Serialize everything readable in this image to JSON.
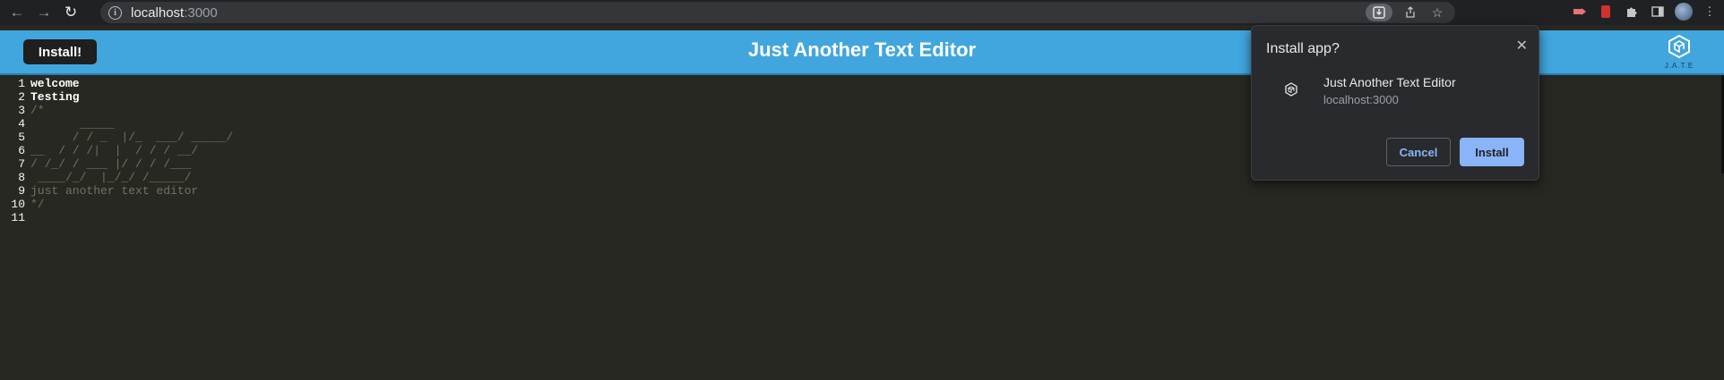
{
  "browser": {
    "url_host": "localhost",
    "url_port": ":3000",
    "icons": [
      "back-arrow-icon",
      "forward-arrow-icon",
      "reload-icon",
      "info-icon",
      "install-app-icon",
      "share-icon",
      "bookmark-star-icon",
      "extension-icon",
      "puzzle-icon",
      "sidebar-icon",
      "profile-avatar",
      "kebab-menu-icon"
    ]
  },
  "app": {
    "install_button": "Install!",
    "title": "Just Another Text Editor",
    "logo_text": "J.A.T.E",
    "header_color": "#41a6de"
  },
  "editor": {
    "background": "#272822",
    "lines": [
      {
        "num": "1",
        "text": "welcome",
        "style": "kw"
      },
      {
        "num": "2",
        "text": "Testing",
        "style": "kw"
      },
      {
        "num": "3",
        "text": "/*",
        "style": "comment"
      },
      {
        "num": "4",
        "text": "       _____",
        "style": "comment"
      },
      {
        "num": "5",
        "text": "      / / _  |/_  ___/ _____/",
        "style": "comment"
      },
      {
        "num": "6",
        "text": "__  / / /|  |  / / / __/",
        "style": "comment"
      },
      {
        "num": "7",
        "text": "/ /_/ / ___ |/ / / /___",
        "style": "comment"
      },
      {
        "num": "8",
        "text": " ____/_/  |_/_/ /_____/",
        "style": "comment"
      },
      {
        "num": "9",
        "text": "just another text editor",
        "style": "comment"
      },
      {
        "num": "10",
        "text": "*/",
        "style": "comment"
      },
      {
        "num": "11",
        "text": "",
        "style": "comment"
      }
    ]
  },
  "install_dialog": {
    "title": "Install app?",
    "app_name": "Just Another Text Editor",
    "app_url": "localhost:3000",
    "cancel_label": "Cancel",
    "install_label": "Install",
    "accent": "#8ab4f8"
  }
}
